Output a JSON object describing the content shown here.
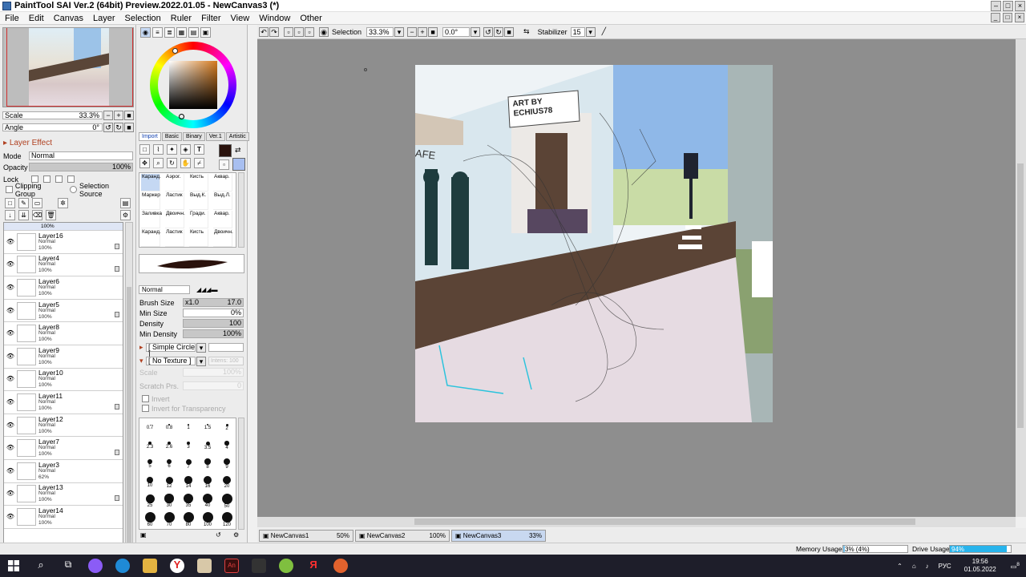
{
  "window": {
    "title": "PaintTool SAI Ver.2 (64bit) Preview.2022.01.05 - NewCanvas3 (*)"
  },
  "menu": [
    "File",
    "Edit",
    "Canvas",
    "Layer",
    "Selection",
    "Ruler",
    "Filter",
    "View",
    "Window",
    "Other"
  ],
  "navigator": {
    "scale_label": "Scale",
    "scale_value": "33.3%",
    "angle_label": "Angle",
    "angle_value": "0°"
  },
  "layer_props": {
    "effect_label": "Layer Effect",
    "mode_label": "Mode",
    "mode_value": "Normal",
    "opacity_label": "Opacity",
    "opacity_value": "100%",
    "lock_label": "Lock",
    "clipping_group": "Clipping Group",
    "selection_source": "Selection Source"
  },
  "layers": [
    {
      "name": "Layer16",
      "mode": "Normal",
      "opacity": "100%",
      "locked": true
    },
    {
      "name": "Layer4",
      "mode": "Normal",
      "opacity": "100%",
      "locked": true
    },
    {
      "name": "Layer6",
      "mode": "Normal",
      "opacity": "100%",
      "locked": false
    },
    {
      "name": "Layer5",
      "mode": "Normal",
      "opacity": "100%",
      "locked": true
    },
    {
      "name": "Layer8",
      "mode": "Normal",
      "opacity": "100%",
      "locked": false
    },
    {
      "name": "Layer9",
      "mode": "Normal",
      "opacity": "100%",
      "locked": false
    },
    {
      "name": "Layer10",
      "mode": "Normal",
      "opacity": "100%",
      "locked": false
    },
    {
      "name": "Layer11",
      "mode": "Normal",
      "opacity": "100%",
      "locked": true
    },
    {
      "name": "Layer12",
      "mode": "Normal",
      "opacity": "100%",
      "locked": false
    },
    {
      "name": "Layer7",
      "mode": "Normal",
      "opacity": "100%",
      "locked": true
    },
    {
      "name": "Layer3",
      "mode": "Normal",
      "opacity": "62%",
      "locked": false
    },
    {
      "name": "Layer13",
      "mode": "Normal",
      "opacity": "100%",
      "locked": true
    },
    {
      "name": "Layer14",
      "mode": "Normal",
      "opacity": "100%",
      "locked": false
    }
  ],
  "top_layer_opacity": "100%",
  "tool_tabs": [
    "Import",
    "Basic",
    "Binary",
    "Ver.1",
    "Artistic"
  ],
  "brushes": [
    "Каранд.",
    "Аэрог.",
    "Кисть",
    "Аквар.",
    "Маркер",
    "Ластик",
    "Выд.К.",
    "Выд.Л.",
    "Заливка",
    "Двоичн.",
    "Гради.",
    "Аквар.",
    "Каранд.",
    "Ластик",
    "Кисть",
    "Двоичн."
  ],
  "brush_settings": {
    "blend_mode": "Normal",
    "size_label": "Brush Size",
    "size_mult": "x1.0",
    "size_value": "17.0",
    "min_size_label": "Min Size",
    "min_size_value": "0%",
    "density_label": "Density",
    "density_value": "100",
    "min_density_label": "Min Density",
    "min_density_value": "100%",
    "shape": "[ Simple Circle ]",
    "texture": "[ No Texture ]",
    "intens": "Intens: 100",
    "scale_label": "Scale",
    "scale_value": "100%",
    "scratch_label": "Scratch Prs.",
    "scratch_value": "0",
    "invert": "Invert",
    "invert_transparency": "Invert for Transparency"
  },
  "brush_sizes": [
    "0.7",
    "0.8",
    "1",
    "1.5",
    "2",
    "2.3",
    "2.6",
    "3",
    "3.5",
    "4",
    "5",
    "6",
    "7",
    "8",
    "9",
    "10",
    "12",
    "14",
    "16",
    "20",
    "25",
    "30",
    "35",
    "40",
    "50",
    "60",
    "70",
    "80",
    "100",
    "120"
  ],
  "canvas_toolbar": {
    "selection_label": "Selection",
    "zoom": "33.3%",
    "angle": "0.0°",
    "stabilizer_label": "Stabilizer",
    "stabilizer_value": "15"
  },
  "sign_text": "ART BY ECHIUS78",
  "cafe_text": "AFE",
  "doc_tabs": [
    {
      "name": "NewCanvas1",
      "zoom": "50%",
      "active": false
    },
    {
      "name": "NewCanvas2",
      "zoom": "100%",
      "active": false
    },
    {
      "name": "NewCanvas3",
      "zoom": "33%",
      "active": true
    }
  ],
  "status": {
    "memory_label": "Memory Usage",
    "memory_value": "3% (4%)",
    "memory_pct": 3,
    "drive_label": "Drive Usage",
    "drive_value": "94%",
    "drive_pct": 94
  },
  "taskbar": {
    "lang": "РУС",
    "time": "19:56",
    "date": "01.05.2022",
    "notifications": "8"
  },
  "colors": {
    "primary": "#2a120c",
    "secondary": "#a8bff0"
  }
}
